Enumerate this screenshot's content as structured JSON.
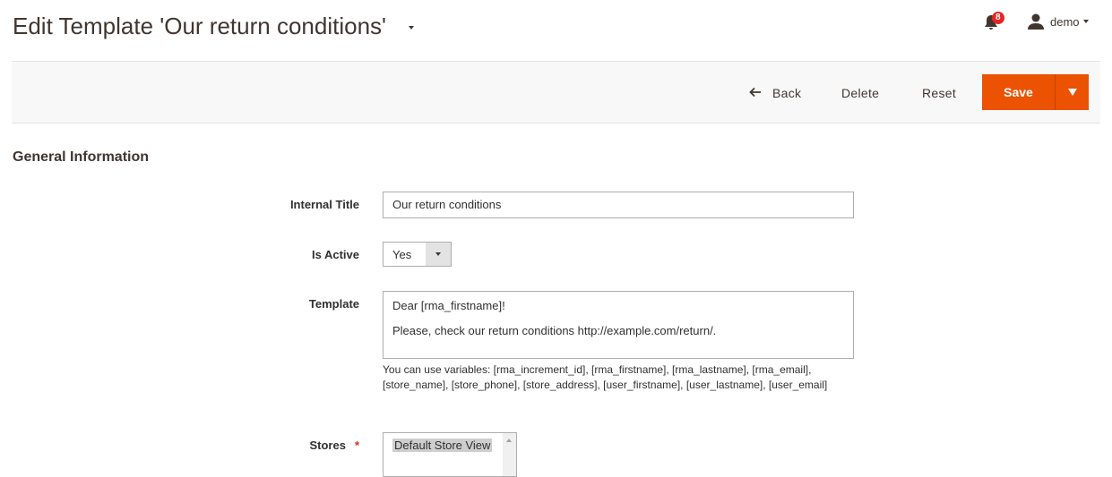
{
  "header": {
    "title": "Edit Template 'Our return conditions'",
    "notifications_count": "8",
    "user_name": "demo"
  },
  "toolbar": {
    "back": "Back",
    "delete": "Delete",
    "reset": "Reset",
    "save": "Save",
    "accent": "#eb5202"
  },
  "section": {
    "title": "General Information"
  },
  "form": {
    "internal_title": {
      "label": "Internal Title",
      "value": "Our return conditions"
    },
    "is_active": {
      "label": "Is Active",
      "value": "Yes"
    },
    "template": {
      "label": "Template",
      "line1": "Dear [rma_firstname]!",
      "line2": "Please, check our return conditions http://example.com/return/.",
      "note": "You can use variables: [rma_increment_id], [rma_firstname], [rma_lastname], [rma_email], [store_name], [store_phone], [store_address], [user_firstname], [user_lastname], [user_email]"
    },
    "stores": {
      "label": "Stores",
      "required": "*",
      "options": [
        "Default Store View"
      ]
    }
  }
}
